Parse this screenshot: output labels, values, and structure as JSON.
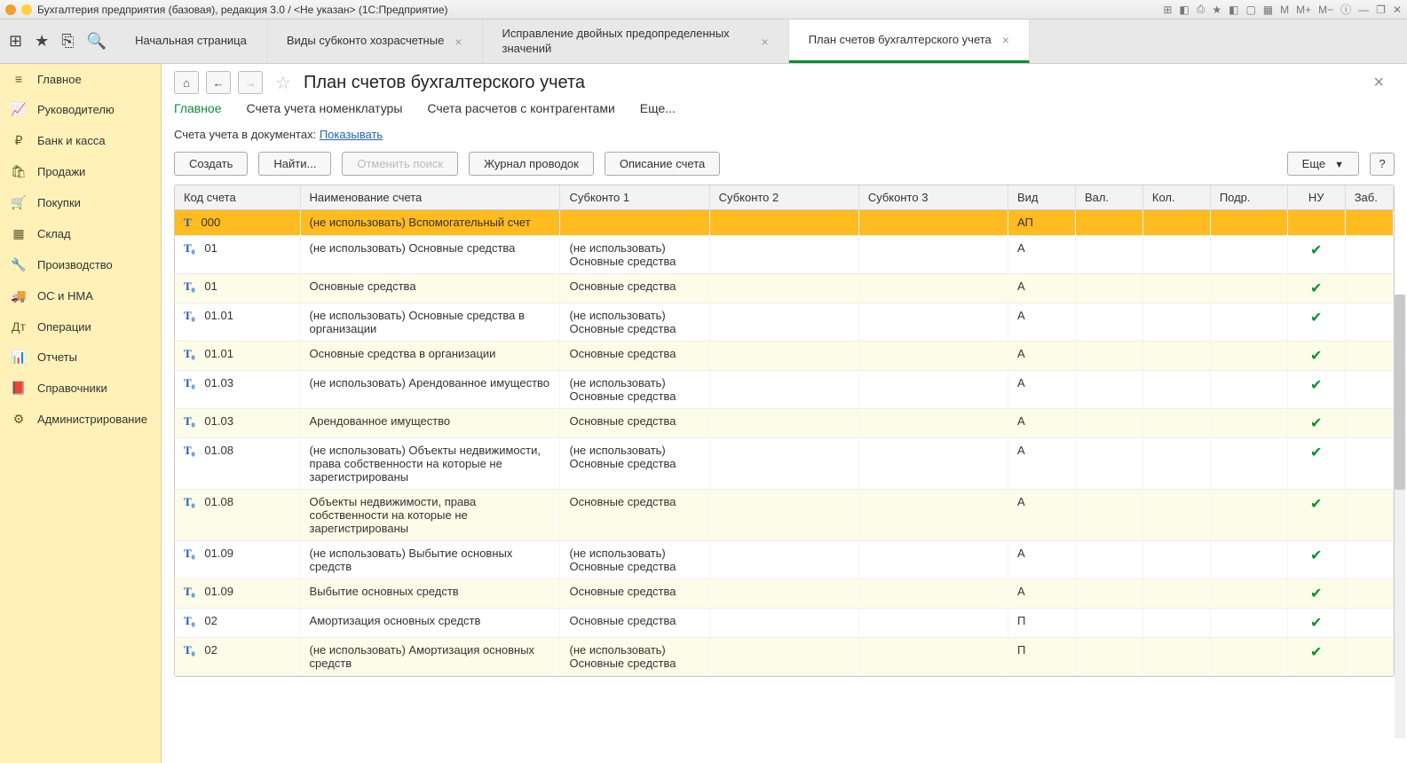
{
  "window": {
    "title": "Бухгалтерия предприятия (базовая), редакция 3.0 / <Не указан>  (1С:Предприятие)"
  },
  "topIcons": [
    "⊞",
    "★",
    "⎘",
    "🔍"
  ],
  "tabs": [
    {
      "label": "Начальная страница",
      "closable": false
    },
    {
      "label": "Виды субконто хозрасчетные",
      "closable": true
    },
    {
      "label": "Исправление двойных предопределенных значений",
      "closable": true
    },
    {
      "label": "План счетов бухгалтерского учета",
      "closable": true,
      "active": true
    }
  ],
  "sidebar": [
    {
      "icon": "≡",
      "label": "Главное"
    },
    {
      "icon": "📈",
      "label": "Руководителю"
    },
    {
      "icon": "₽",
      "label": "Банк и касса"
    },
    {
      "icon": "🛍",
      "label": "Продажи"
    },
    {
      "icon": "🛒",
      "label": "Покупки"
    },
    {
      "icon": "▦",
      "label": "Склад"
    },
    {
      "icon": "🔧",
      "label": "Производство"
    },
    {
      "icon": "🚚",
      "label": "ОС и НМА"
    },
    {
      "icon": "Дт",
      "label": "Операции"
    },
    {
      "icon": "📊",
      "label": "Отчеты"
    },
    {
      "icon": "📕",
      "label": "Справочники"
    },
    {
      "icon": "⚙",
      "label": "Администрирование"
    }
  ],
  "page": {
    "title": "План счетов бухгалтерского учета",
    "subnav": [
      "Главное",
      "Счета учета номенклатуры",
      "Счета расчетов с контрагентами",
      "Еще..."
    ],
    "docline_label": "Счета учета в документах:  ",
    "docline_link": "Показывать",
    "toolbar": [
      "Создать",
      "Найти...",
      "Отменить поиск",
      "Журнал проводок",
      "Описание счета"
    ],
    "more": "Еще",
    "help": "?"
  },
  "columns": [
    "Код счета",
    "Наименование счета",
    "Субконто 1",
    "Субконто 2",
    "Субконто 3",
    "Вид",
    "Вал.",
    "Кол.",
    "Подр.",
    "НУ",
    "Заб."
  ],
  "rows": [
    {
      "icon": "T",
      "code": "000",
      "name": "(не использовать) Вспомогательный счет",
      "s1": "",
      "s2": "",
      "s3": "",
      "vid": "АП",
      "nu": false,
      "sel": true
    },
    {
      "icon": "T₀",
      "code": "01",
      "name": "(не использовать) Основные средства",
      "s1": "(не использовать) Основные средства",
      "s2": "",
      "s3": "",
      "vid": "А",
      "nu": true
    },
    {
      "icon": "T₀",
      "code": "01",
      "name": "Основные средства",
      "s1": "Основные средства",
      "s2": "",
      "s3": "",
      "vid": "А",
      "nu": true,
      "alt": true
    },
    {
      "icon": "T₀",
      "code": "01.01",
      "name": "(не использовать) Основные средства в организации",
      "s1": "(не использовать) Основные средства",
      "s2": "",
      "s3": "",
      "vid": "А",
      "nu": true
    },
    {
      "icon": "T₀",
      "code": "01.01",
      "name": "Основные средства в организации",
      "s1": "Основные средства",
      "s2": "",
      "s3": "",
      "vid": "А",
      "nu": true,
      "alt": true
    },
    {
      "icon": "T₀",
      "code": "01.03",
      "name": "(не использовать) Арендованное имущество",
      "s1": "(не использовать) Основные средства",
      "s2": "",
      "s3": "",
      "vid": "А",
      "nu": true
    },
    {
      "icon": "T₀",
      "code": "01.03",
      "name": "Арендованное имущество",
      "s1": "Основные средства",
      "s2": "",
      "s3": "",
      "vid": "А",
      "nu": true,
      "alt": true
    },
    {
      "icon": "T₀",
      "code": "01.08",
      "name": "(не использовать) Объекты недвижимости, права собственности на которые не зарегистрированы",
      "s1": "(не использовать) Основные средства",
      "s2": "",
      "s3": "",
      "vid": "А",
      "nu": true
    },
    {
      "icon": "T₀",
      "code": "01.08",
      "name": "Объекты недвижимости, права собственности на которые не зарегистрированы",
      "s1": "Основные средства",
      "s2": "",
      "s3": "",
      "vid": "А",
      "nu": true,
      "alt": true
    },
    {
      "icon": "T₀",
      "code": "01.09",
      "name": "(не использовать) Выбытие основных средств",
      "s1": "(не использовать) Основные средства",
      "s2": "",
      "s3": "",
      "vid": "А",
      "nu": true
    },
    {
      "icon": "T₀",
      "code": "01.09",
      "name": "Выбытие основных средств",
      "s1": "Основные средства",
      "s2": "",
      "s3": "",
      "vid": "А",
      "nu": true,
      "alt": true
    },
    {
      "icon": "T₀",
      "code": "02",
      "name": "Амортизация основных средств",
      "s1": "Основные средства",
      "s2": "",
      "s3": "",
      "vid": "П",
      "nu": true
    },
    {
      "icon": "T₀",
      "code": "02",
      "name": "(не использовать) Амортизация основных средств",
      "s1": "(не использовать) Основные средства",
      "s2": "",
      "s3": "",
      "vid": "П",
      "nu": true,
      "alt": true
    }
  ],
  "titlebarRight": [
    "⊞",
    "◧",
    "⎙",
    "★",
    "◧",
    "▢",
    "▦",
    "M",
    "M+",
    "M−",
    "ⓘ",
    "—",
    "❐",
    "✕"
  ]
}
